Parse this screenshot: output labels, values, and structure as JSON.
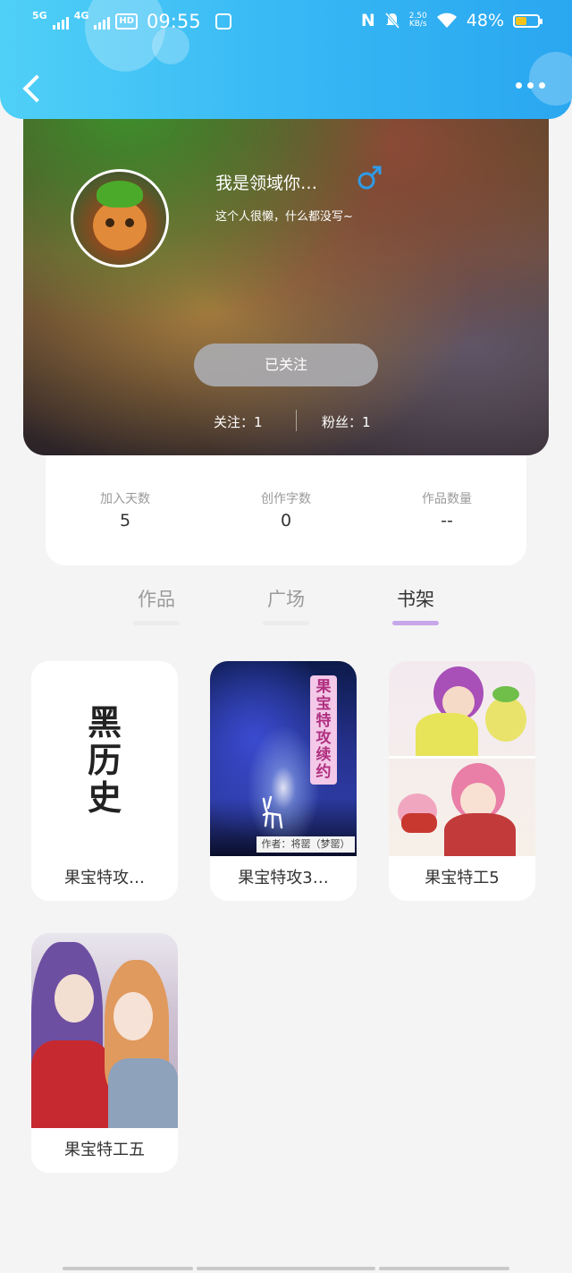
{
  "status_bar": {
    "network_1": "5G",
    "network_2": "4G",
    "hd": "HD",
    "time": "09:55",
    "nfc": "N",
    "speed_value": "2.50",
    "speed_unit": "KB/s",
    "battery": "48%"
  },
  "header": {
    "back_icon": "chevron-left-icon",
    "more_icon": "more-dots-icon"
  },
  "profile": {
    "username": "我是领域你…",
    "gender_symbol": "♂",
    "bio": "这个人很懒，什么都没写~",
    "follow_button": "已关注",
    "following": "关注：1",
    "followers": "粉丝：1"
  },
  "stats": [
    {
      "label": "加入天数",
      "value": "5"
    },
    {
      "label": "创作字数",
      "value": "0"
    },
    {
      "label": "作品数量",
      "value": "--"
    }
  ],
  "tabs": [
    {
      "label": "作品",
      "active": false
    },
    {
      "label": "广场",
      "active": false
    },
    {
      "label": "书架",
      "active": true
    }
  ],
  "books": [
    {
      "title": "果宝特攻…",
      "cover_text": "黑\n历\n史"
    },
    {
      "title": "果宝特攻3…",
      "cover_text": "果宝特攻续约",
      "cover_author": "作者：将罂（梦罂）"
    },
    {
      "title": "果宝特工5"
    },
    {
      "title": "果宝特工五"
    }
  ],
  "colors": {
    "header_start": "#4fd0f7",
    "header_end": "#2aa7f0",
    "tab_active_underline": "#c7a6ea",
    "gender_icon": "#2f9be8"
  }
}
